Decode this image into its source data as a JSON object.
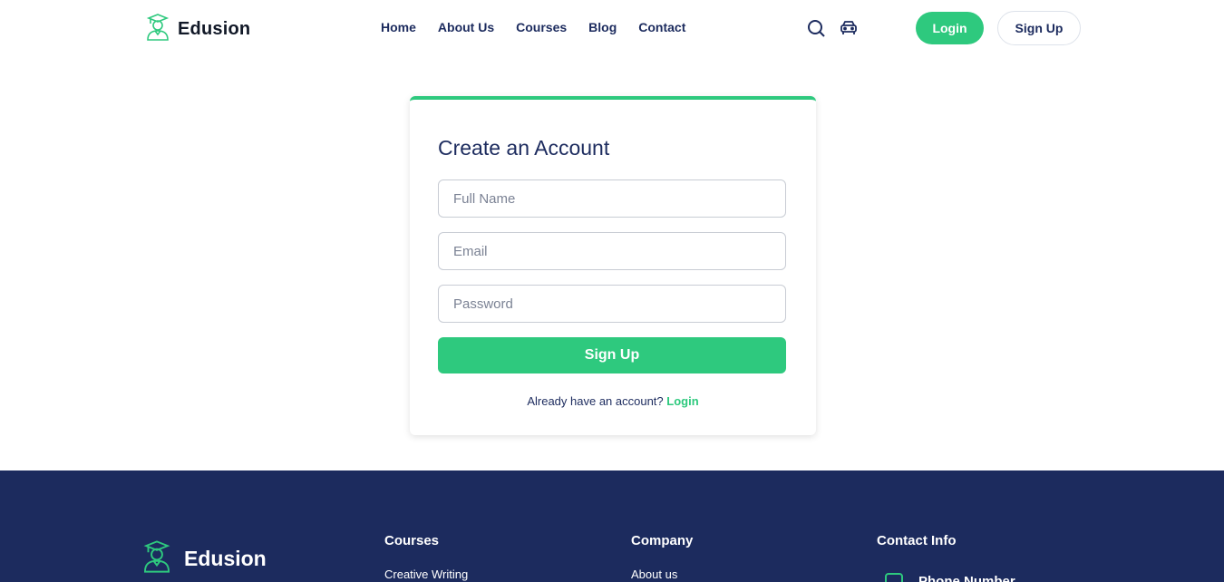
{
  "header": {
    "brand": "Edusion",
    "nav": [
      "Home",
      "About Us",
      "Courses",
      "Blog",
      "Contact"
    ],
    "login_label": "Login",
    "signup_label": "Sign Up",
    "icons": [
      "search-icon",
      "cart-icon"
    ]
  },
  "form": {
    "title": "Create an Account",
    "full_name_placeholder": "Full Name",
    "email_placeholder": "Email",
    "password_placeholder": "Password",
    "submit_label": "Sign Up",
    "already_text": "Already have an account?",
    "login_link": "Login"
  },
  "footer": {
    "brand": "Edusion",
    "courses_heading": "Courses",
    "courses_first_link": "Creative Writing",
    "company_heading": "Company",
    "company_first_link": "About us",
    "contact_heading": "Contact Info",
    "contact_first_label": "Phone Number"
  },
  "colors": {
    "accent": "#2ec97e",
    "navy": "#1c2b5e"
  }
}
